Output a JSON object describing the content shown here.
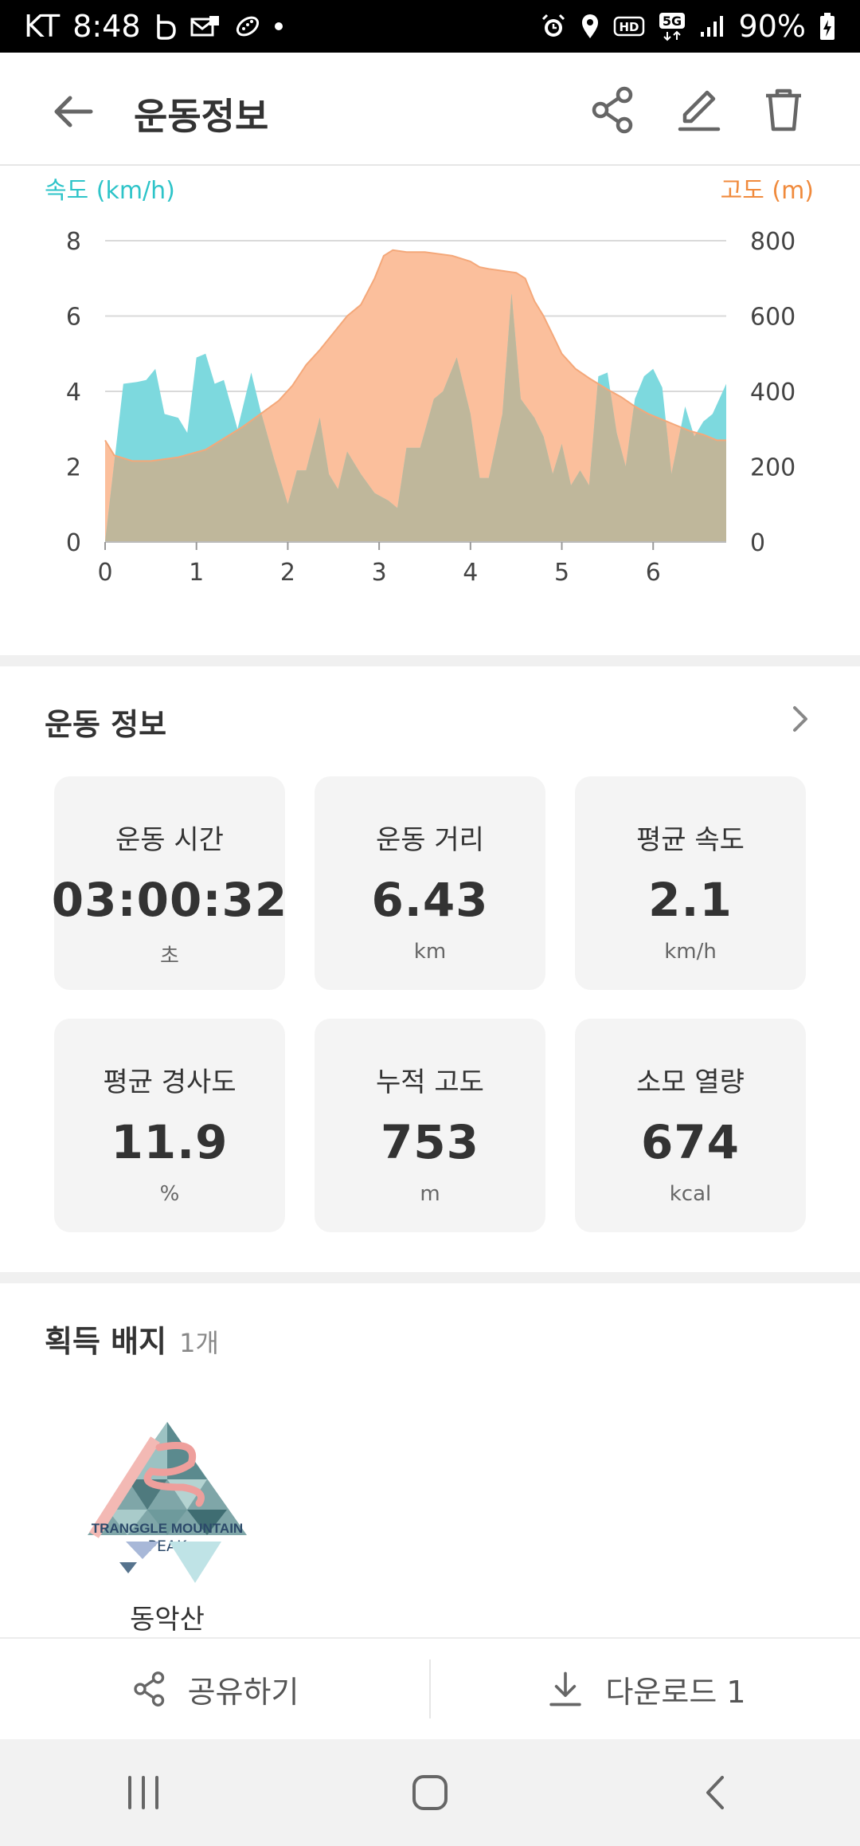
{
  "status_bar": {
    "carrier": "KT",
    "time": "8:48",
    "battery": "90%"
  },
  "header": {
    "title": "운동정보"
  },
  "chart_data": {
    "type": "area",
    "left_axis_label": "속도 (km/h)",
    "right_axis_label": "고도 (m)",
    "x_ticks": [
      "0",
      "1",
      "2",
      "3",
      "4",
      "5",
      "6"
    ],
    "left_ticks": [
      "0",
      "2",
      "4",
      "6",
      "8"
    ],
    "right_ticks": [
      "0",
      "200",
      "400",
      "600",
      "800"
    ],
    "xlim": [
      0,
      6.8
    ],
    "ylim_left": [
      0,
      8
    ],
    "ylim_right": [
      0,
      800
    ],
    "grid": true,
    "colors": {
      "speed": "#7dd9de",
      "elevation": "#fbbf9c",
      "overlap": "#bfb79b",
      "elevation_line": "#f4a87a"
    },
    "series": [
      {
        "axis": "left",
        "x": [
          0,
          0.2,
          0.35,
          0.45,
          0.55,
          0.65,
          0.8,
          0.9,
          1.0,
          1.1,
          1.2,
          1.3,
          1.45,
          1.6,
          1.7,
          1.85,
          2.0,
          2.1,
          2.2,
          2.35,
          2.45,
          2.55,
          2.65,
          2.8,
          2.95,
          3.1,
          3.2,
          3.3,
          3.45,
          3.6,
          3.7,
          3.85,
          4.0,
          4.1,
          4.2,
          4.35,
          4.45,
          4.55,
          4.7,
          4.8,
          4.9,
          5.0,
          5.1,
          5.2,
          5.3,
          5.4,
          5.5,
          5.6,
          5.7,
          5.8,
          5.9,
          6.0,
          6.1,
          6.2,
          6.35,
          6.45,
          6.55,
          6.65,
          6.8
        ],
        "y": [
          0,
          4.2,
          4.25,
          4.3,
          4.6,
          3.4,
          3.3,
          2.9,
          4.9,
          5.0,
          4.2,
          4.3,
          3.0,
          4.5,
          3.5,
          2.2,
          1.0,
          1.9,
          1.9,
          3.3,
          1.8,
          1.4,
          2.4,
          1.8,
          1.3,
          1.1,
          0.9,
          2.5,
          2.5,
          3.8,
          4.0,
          4.9,
          3.4,
          1.7,
          1.7,
          3.4,
          6.6,
          3.8,
          3.3,
          2.8,
          1.8,
          2.6,
          1.5,
          1.9,
          1.5,
          4.4,
          4.5,
          2.9,
          2.0,
          3.8,
          4.4,
          4.6,
          4.1,
          1.8,
          3.6,
          2.8,
          3.2,
          3.4,
          4.2
        ]
      },
      {
        "axis": "right",
        "x": [
          0,
          0.1,
          0.3,
          0.5,
          0.8,
          1.1,
          1.3,
          1.5,
          1.7,
          1.9,
          2.05,
          2.2,
          2.35,
          2.5,
          2.65,
          2.8,
          2.95,
          3.05,
          3.15,
          3.3,
          3.5,
          3.8,
          4.0,
          4.1,
          4.2,
          4.35,
          4.5,
          4.6,
          4.7,
          4.8,
          4.9,
          5.0,
          5.15,
          5.3,
          5.5,
          5.65,
          5.8,
          5.95,
          6.1,
          6.25,
          6.4,
          6.55,
          6.7,
          6.8
        ],
        "y": [
          270,
          230,
          215,
          215,
          225,
          245,
          275,
          305,
          340,
          375,
          415,
          470,
          510,
          555,
          600,
          630,
          700,
          760,
          775,
          770,
          770,
          760,
          745,
          730,
          725,
          720,
          715,
          700,
          640,
          600,
          550,
          500,
          460,
          435,
          405,
          385,
          360,
          340,
          325,
          310,
          295,
          285,
          270,
          270
        ]
      }
    ]
  },
  "workout": {
    "title": "운동 정보",
    "cards": [
      {
        "label": "운동 시간",
        "value": "03:00:32",
        "unit": "초"
      },
      {
        "label": "운동 거리",
        "value": "6.43",
        "unit": "km"
      },
      {
        "label": "평균 속도",
        "value": "2.1",
        "unit": "km/h"
      },
      {
        "label": "평균 경사도",
        "value": "11.9",
        "unit": "%"
      },
      {
        "label": "누적 고도",
        "value": "753",
        "unit": "m"
      },
      {
        "label": "소모 열량",
        "value": "674",
        "unit": "kcal"
      }
    ]
  },
  "badges": {
    "title": "획득 배지",
    "count": "1개",
    "items": [
      {
        "name": "동악산",
        "logo_line1": "TRANGGLE MOUNTAIN",
        "logo_line2": "PEAK"
      }
    ]
  },
  "actions": {
    "share_label": "공유하기",
    "download_label": "다운로드 1"
  },
  "icons": {
    "back": "arrow-left-icon",
    "share": "share-icon",
    "edit": "pencil-icon",
    "delete": "trash-icon",
    "download": "download-icon"
  }
}
